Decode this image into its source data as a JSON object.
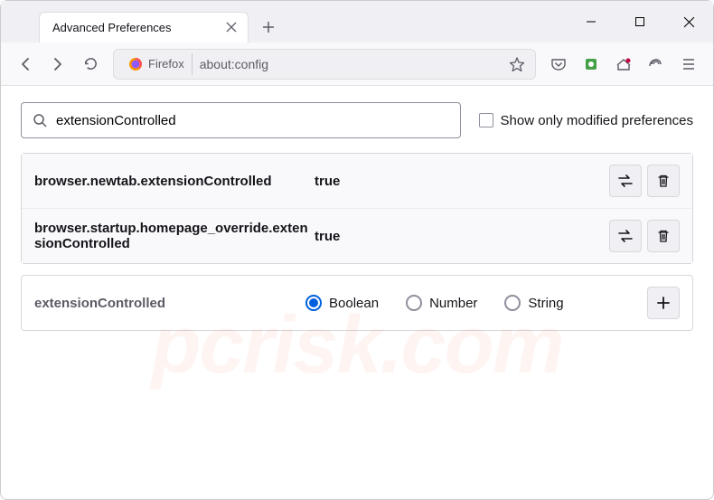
{
  "window": {
    "tab_title": "Advanced Preferences"
  },
  "toolbar": {
    "identity_label": "Firefox",
    "url": "about:config"
  },
  "search": {
    "value": "extensionControlled",
    "checkbox_label": "Show only modified preferences"
  },
  "prefs": [
    {
      "name": "browser.newtab.extensionControlled",
      "value": "true"
    },
    {
      "name": "browser.startup.homepage_override.extensionControlled",
      "value": "true"
    }
  ],
  "new_pref": {
    "name": "extensionControlled",
    "types": [
      "Boolean",
      "Number",
      "String"
    ],
    "selected": "Boolean"
  },
  "colors": {
    "accent": "#0060df"
  },
  "watermark": "pcrisk.com"
}
